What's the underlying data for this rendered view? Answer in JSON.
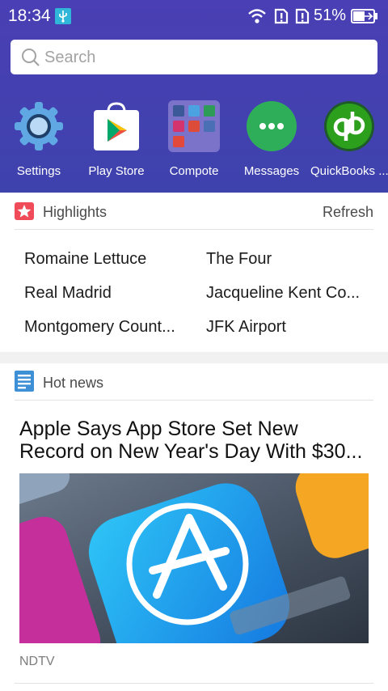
{
  "status_bar": {
    "time": "18:34",
    "battery": "51%"
  },
  "search": {
    "placeholder": "Search"
  },
  "apps": [
    {
      "label": "Settings",
      "icon": "settings-gear-icon"
    },
    {
      "label": "Play Store",
      "icon": "play-store-icon"
    },
    {
      "label": "Compote",
      "icon": "app-folder-icon"
    },
    {
      "label": "Messages",
      "icon": "messages-icon"
    },
    {
      "label": "QuickBooks ...",
      "icon": "quickbooks-icon"
    }
  ],
  "highlights": {
    "title": "Highlights",
    "refresh": "Refresh",
    "items": [
      "Romaine Lettuce",
      "The Four",
      "Real Madrid",
      "Jacqueline Kent Co...",
      "Montgomery Count...",
      "JFK Airport"
    ]
  },
  "hot_news": {
    "title": "Hot news",
    "headline_line1": "Apple Says App Store Set New",
    "headline_line2": "Record on New Year's Day With $30...",
    "source": "NDTV"
  },
  "colors": {
    "header_bg": "#4340b0",
    "highlight_icon": "#ef4b58",
    "news_icon": "#3d8fd6",
    "messages_green": "#2fae59",
    "quickbooks_green": "#2ca01c"
  }
}
